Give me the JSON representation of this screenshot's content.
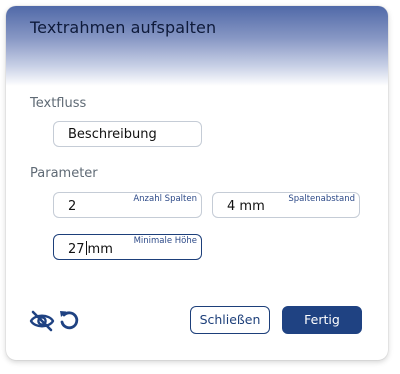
{
  "dialog": {
    "title": "Textrahmen aufspalten"
  },
  "textflow": {
    "section_label": "Textfluss",
    "value": "Beschreibung"
  },
  "params": {
    "section_label": "Parameter",
    "columns": {
      "label": "Anzahl Spalten",
      "value": "2"
    },
    "gap": {
      "label": "Spaltenabstand",
      "value": "4 mm"
    },
    "min_height": {
      "label": "Minimale Höhe",
      "value_before_caret": "27",
      "value_after_caret": "mm"
    }
  },
  "footer": {
    "close_label": "Schließen",
    "done_label": "Fertig",
    "icons": [
      "eye-slash-icon",
      "reset-icon"
    ]
  },
  "colors": {
    "accent": "#1f4282",
    "header_gradient_top": "#5069a8",
    "label_text": "#2d4a88"
  }
}
